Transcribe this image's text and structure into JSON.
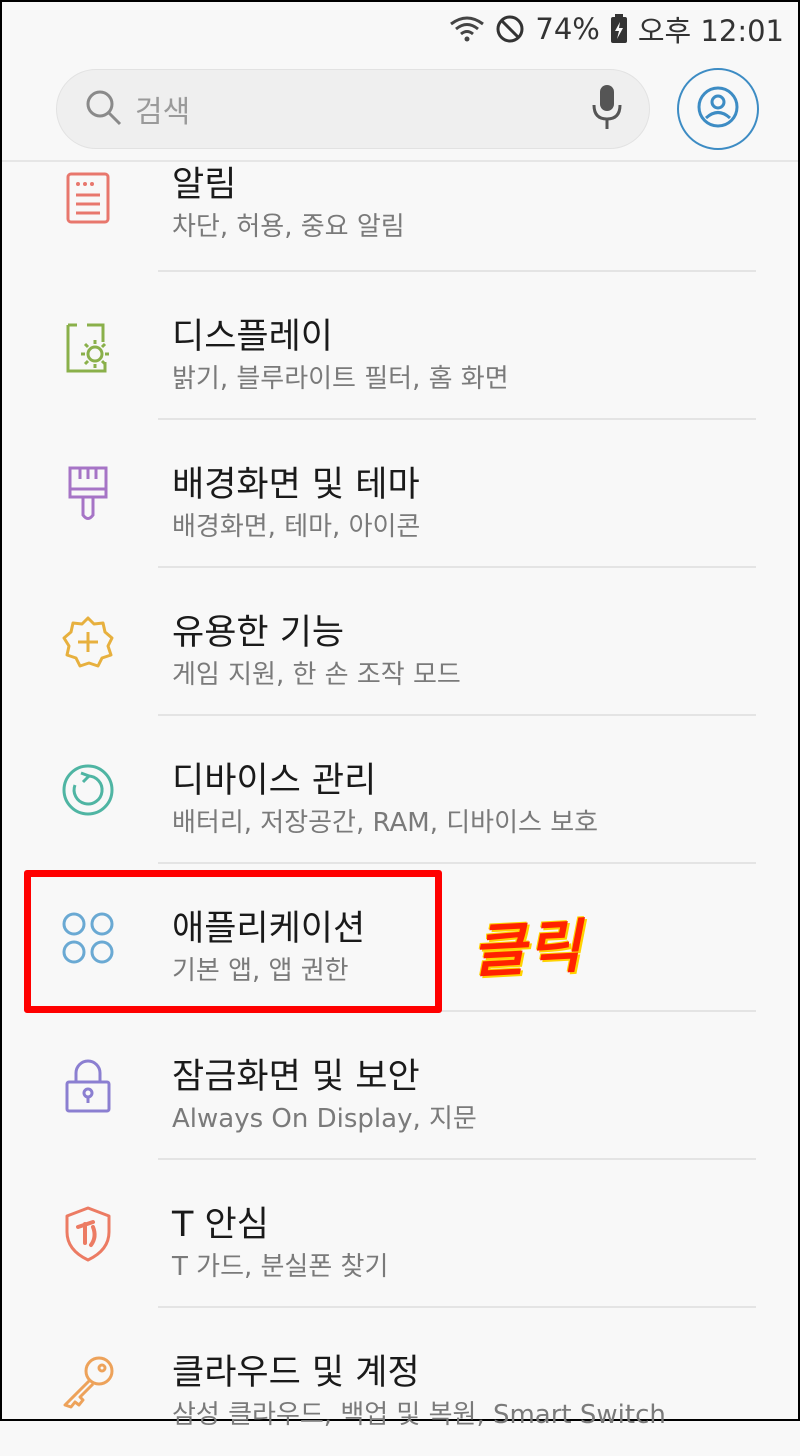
{
  "status_bar": {
    "battery": "74%",
    "time": "오후 12:01"
  },
  "search": {
    "placeholder": "검색"
  },
  "items": [
    {
      "title": "알림",
      "sub": "차단, 허용, 중요 알림",
      "icon": "notification-icon",
      "color": "#e8776d"
    },
    {
      "title": "디스플레이",
      "sub": "밝기, 블루라이트 필터, 홈 화면",
      "icon": "display-icon",
      "color": "#8ab04a"
    },
    {
      "title": "배경화면 및 테마",
      "sub": "배경화면, 테마, 아이콘",
      "icon": "paint-brush-icon",
      "color": "#a674c6"
    },
    {
      "title": "유용한 기능",
      "sub": "게임 지원, 한 손 조작 모드",
      "icon": "gear-plus-icon",
      "color": "#e7b03e"
    },
    {
      "title": "디바이스 관리",
      "sub": "배터리, 저장공간, RAM, 디바이스 보호",
      "icon": "refresh-icon",
      "color": "#4fb5a3"
    },
    {
      "title": "애플리케이션",
      "sub": "기본 앱, 앱 권한",
      "icon": "apps-icon",
      "color": "#6aa9d3"
    },
    {
      "title": "잠금화면 및 보안",
      "sub": "Always On Display, 지문",
      "icon": "lock-icon",
      "color": "#8b7fd1"
    },
    {
      "title": "T 안심",
      "sub": "T 가드, 분실폰 찾기",
      "icon": "shield-icon",
      "color": "#ec7b63"
    },
    {
      "title": "클라우드 및 계정",
      "sub": "삼성 클라우드, 백업 및 복원, Smart Switch",
      "icon": "key-icon",
      "color": "#eda25a"
    }
  ],
  "annotation": "클릭"
}
